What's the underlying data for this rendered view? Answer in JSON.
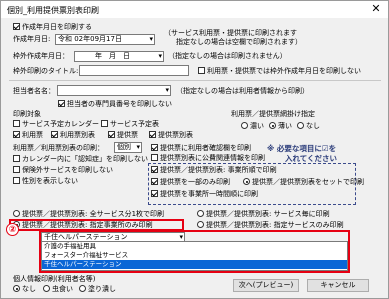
{
  "window": {
    "title": "個別_利用提供票別表印刷",
    "close_glyph": "✕"
  },
  "top": {
    "print_date_check": "作成年月日を印刷する",
    "date_label": "作成年月日:",
    "date_value": "令和 02年09月17日",
    "date_note_line1": "（サービス利用票・提供票に印刷されます",
    "date_note_line2": "指定なしの場合は空欄で印刷されます）",
    "frame_date_label": "枠外作成年月日：",
    "frame_date_value": "年　月　日",
    "frame_date_note": "（指定なしの場合は印刷されません）",
    "frame_title_label": "枠外印刷のタイトル:",
    "frame_title_check": "利用票・提供票では枠外作成年月日を印刷しない"
  },
  "staff": {
    "label": "担当者名名：",
    "note": "（指定なしの場合は利用者情報から印刷）",
    "specialist_check": "担当者の専門員番号を印刷しない"
  },
  "print_target": {
    "label": "印刷対象",
    "items": [
      "サービス予定カレンダー",
      "サービス予定表",
      "利用票",
      "利用票別表",
      "提供票",
      "提供票別表"
    ]
  },
  "shade": {
    "label": "利用票／提供票網掛け指定",
    "options": [
      "濃い",
      "薄い",
      "なし"
    ]
  },
  "billing": {
    "label": "利用票／利用票別表の印刷：",
    "select_value": "個別",
    "left_items": [
      "カレンダー内に「認知症」を印刷しない",
      "保険外サービスを印刷しない",
      "性別を表示しない"
    ],
    "right_items": [
      "提供票に利用者確認欄を印刷",
      "提供票別表に公費関連情報を印刷",
      "提供票／提供票別表: 事業所順で印刷",
      "提供票を一部のみ印刷",
      "提供票／提供票別表をセットで印刷",
      "提供票を事業所一時間順に印刷"
    ]
  },
  "annotation": {
    "line1": "※ 必要な項目に☑を",
    "line2": "入れてください",
    "circle": "②"
  },
  "scope": {
    "all": "提供票／提供票別表: 全サービス分1枚で印刷",
    "service_cat": "提供票／提供票別表: サービス毎に印刷",
    "office": "提供票／提供票別表: 指定事業所のみ印刷",
    "service_type": "提供票／提供票別表: 指定サービスのみ印刷"
  },
  "office_select": {
    "value": "千住ヘルパーステーション",
    "options": [
      "介護の手福祉用具",
      "フォースター介福祉サービス",
      "千住ヘルパーステーション"
    ],
    "selected_index": 2
  },
  "personal": {
    "label": "個人情報印刷(利用者名等)",
    "options": [
      "なし",
      "虫食い",
      "塗り潰し"
    ]
  },
  "buttons": {
    "preview": "次へ(プレビュー)",
    "cancel": "キャンセル"
  }
}
